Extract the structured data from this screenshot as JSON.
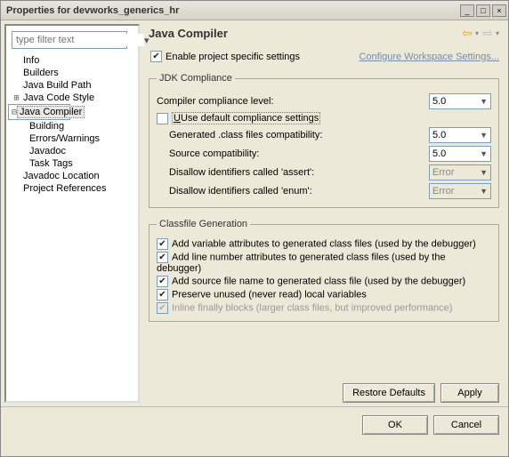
{
  "window": {
    "title": "Properties for devworks_generics_hr"
  },
  "sidebar": {
    "filter_placeholder": "type filter text",
    "items": {
      "info": "Info",
      "builders": "Builders",
      "jbp": "Java Build Path",
      "jcs": "Java Code Style",
      "jc": "Java Compiler",
      "building": "Building",
      "errwarn": "Errors/Warnings",
      "javadoc": "Javadoc",
      "tasktags": "Task Tags",
      "jloc": "Javadoc Location",
      "pref": "Project References"
    }
  },
  "main": {
    "heading": "Java Compiler",
    "enable_label": "Enable project specific settings",
    "workspace_link": "Configure Workspace Settings...",
    "jdk": {
      "legend": "JDK Compliance",
      "level_label": "Compiler compliance level:",
      "level_value": "5.0",
      "usedef_label": "Use default compliance settings",
      "gen_label": "Generated .class files compatibility:",
      "gen_value": "5.0",
      "src_label": "Source compatibility:",
      "src_value": "5.0",
      "assert_label": "Disallow identifiers called 'assert':",
      "assert_value": "Error",
      "enum_label": "Disallow identifiers called 'enum':",
      "enum_value": "Error"
    },
    "cf": {
      "legend": "Classfile Generation",
      "c1": "Add variable attributes to generated class files (used by the debugger)",
      "c2": "Add line number attributes to generated class files (used by the debugger)",
      "c3": "Add source file name to generated class file (used by the debugger)",
      "c4": "Preserve unused (never read) local variables",
      "c5": "Inline finally blocks (larger class files, but improved performance)"
    },
    "buttons": {
      "restore": "Restore Defaults",
      "apply": "Apply",
      "ok": "OK",
      "cancel": "Cancel"
    }
  }
}
